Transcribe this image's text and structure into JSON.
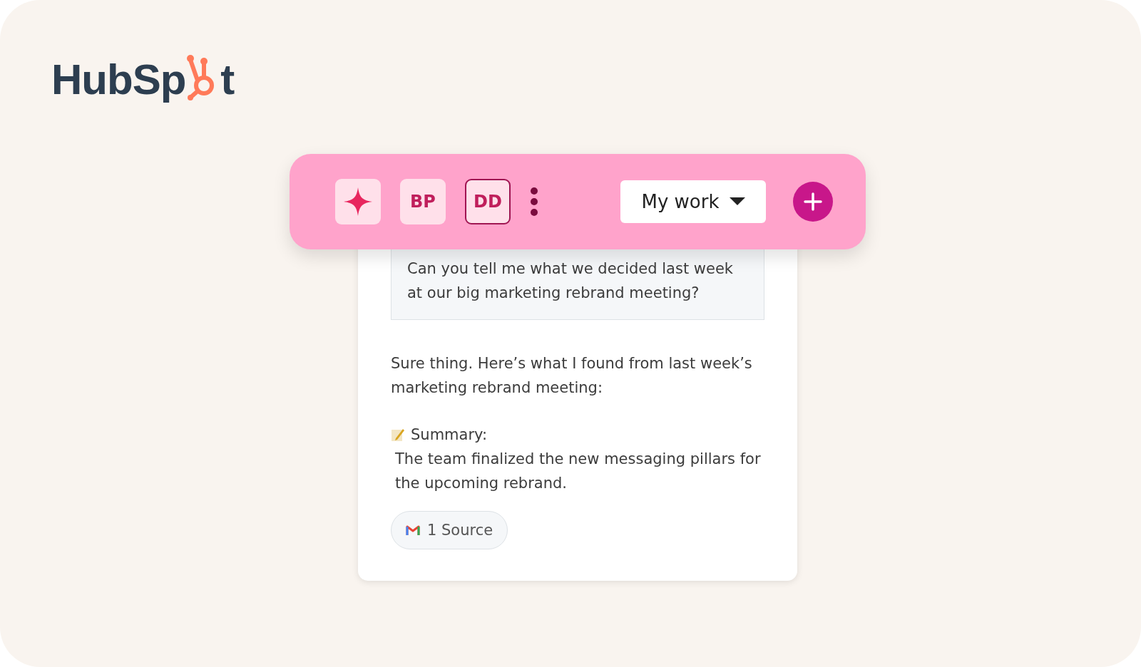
{
  "logo": {
    "before": "HubSp",
    "after": "t"
  },
  "toolbar": {
    "items": [
      {
        "kind": "sparkle",
        "selected": false
      },
      {
        "kind": "avatar",
        "label": "BP",
        "selected": false
      },
      {
        "kind": "avatar",
        "label": "DD",
        "selected": true
      },
      {
        "kind": "more",
        "selected": false
      }
    ],
    "dropdown": {
      "label": "My work"
    }
  },
  "chat": {
    "question": "Can you tell me what we decided last week at our big marketing rebrand meeting?",
    "answer": "Sure thing. Here’s what I found from last week’s marketing rebrand meeting:",
    "summary_label": "Summary:",
    "summary": "The team finalized the new messaging pillars for the upcoming rebrand.",
    "source": "1 Source"
  }
}
